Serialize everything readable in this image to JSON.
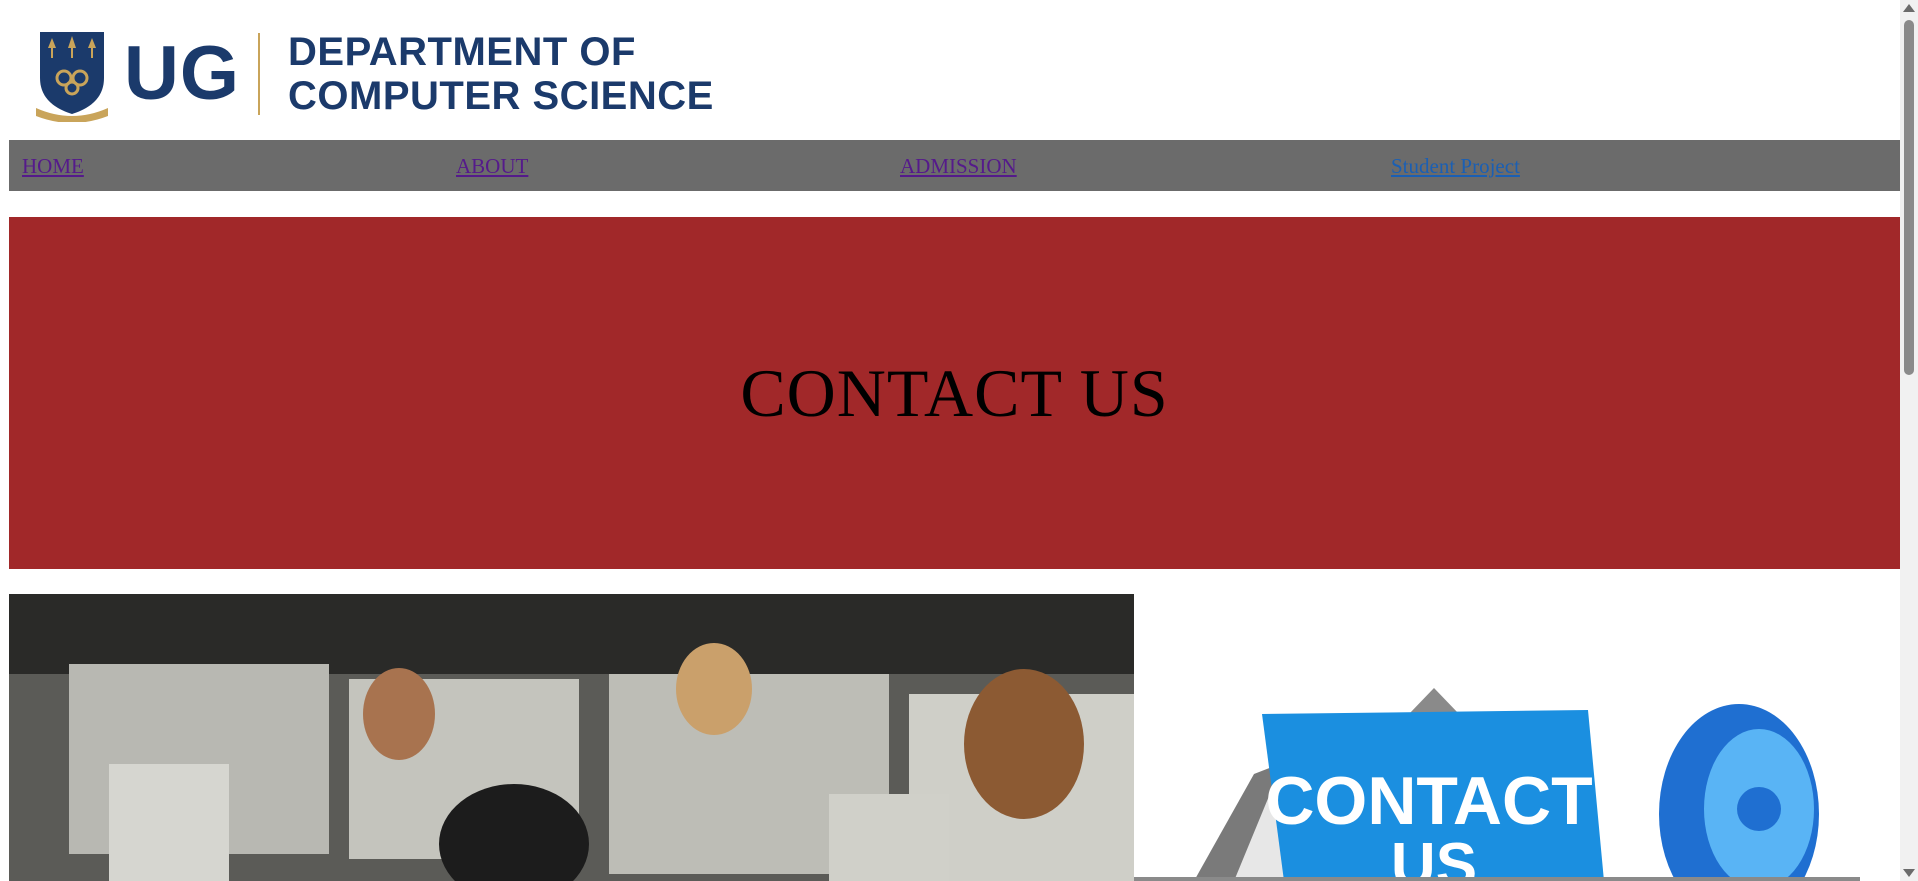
{
  "brand": {
    "short_name": "UG",
    "department_line1": "DEPARTMENT OF",
    "department_line2": "COMPUTER SCIENCE",
    "colors": {
      "navy": "#1b3a6b",
      "gold": "#c9a45a"
    }
  },
  "nav": {
    "items": [
      {
        "label": "HOME",
        "state": "visited"
      },
      {
        "label": "ABOUT",
        "state": "visited"
      },
      {
        "label": "ADMISSION",
        "state": "visited"
      },
      {
        "label": "Student Project",
        "state": "link"
      }
    ],
    "background": "#6b6b6b"
  },
  "hero": {
    "title": "CONTACT US",
    "background": "#a12829"
  },
  "images": {
    "left": "call-center-photo",
    "right": "contact-us-graphic",
    "right_banner_text": "CONTACT",
    "right_banner_text_cut": "US"
  }
}
